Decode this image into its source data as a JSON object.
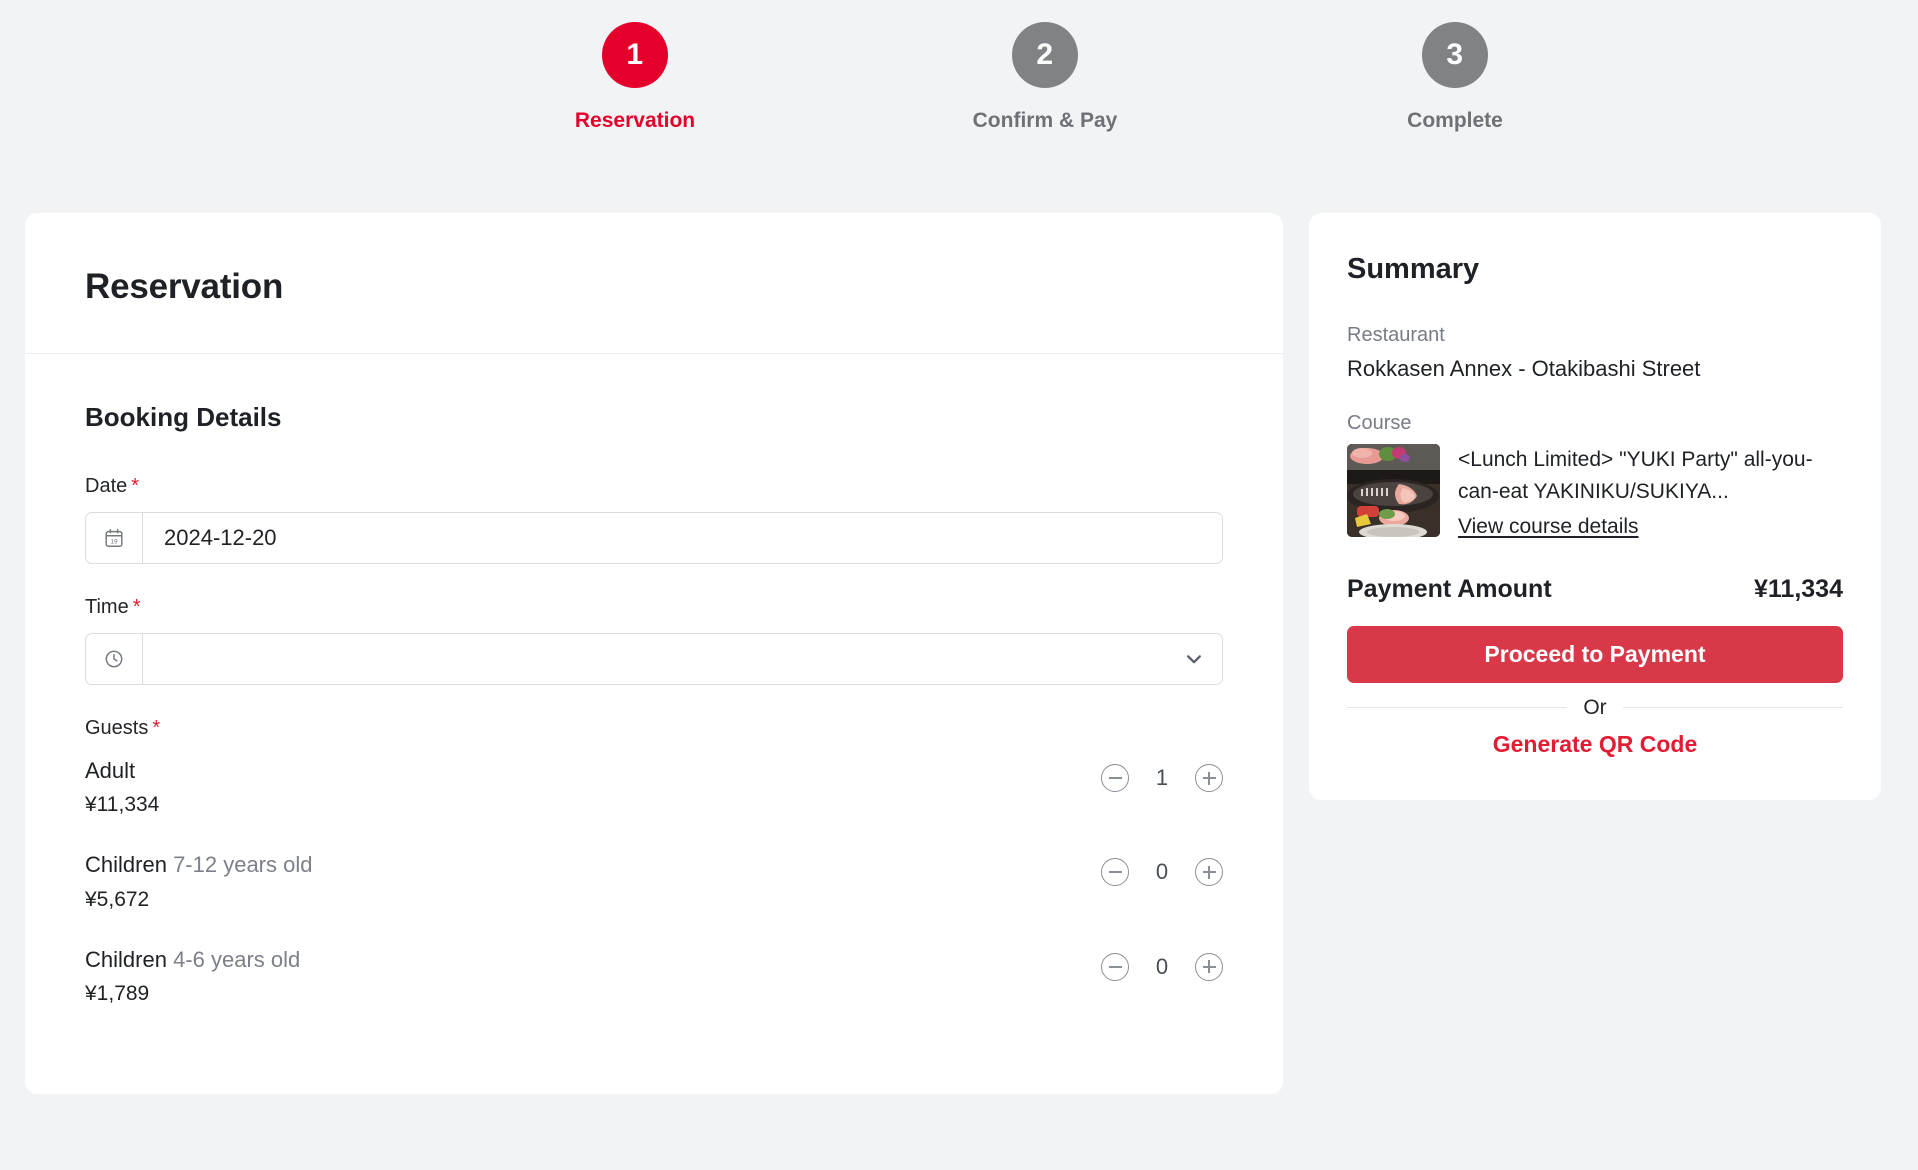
{
  "stepper": {
    "steps": [
      {
        "number": "1",
        "label": "Reservation",
        "state": "active"
      },
      {
        "number": "2",
        "label": "Confirm & Pay",
        "state": "inactive"
      },
      {
        "number": "3",
        "label": "Complete",
        "state": "inactive"
      }
    ]
  },
  "reservation": {
    "heading": "Reservation",
    "section_title": "Booking Details",
    "date": {
      "label": "Date",
      "required_mark": "*",
      "value": "2024-12-20",
      "icon": "calendar-icon",
      "icon_day": "19"
    },
    "time": {
      "label": "Time",
      "required_mark": "*",
      "value": "",
      "icon": "clock-icon",
      "caret": "chevron-down-icon"
    },
    "guests": {
      "label": "Guests",
      "required_mark": "*",
      "rows": [
        {
          "name": "Adult",
          "age": "",
          "price": "¥11,334",
          "count": "1"
        },
        {
          "name": "Children",
          "age": "7-12 years old",
          "price": "¥5,672",
          "count": "0"
        },
        {
          "name": "Children",
          "age": "4-6 years old",
          "price": "¥1,789",
          "count": "0"
        }
      ],
      "decrement_icon": "minus-circle-icon",
      "increment_icon": "plus-circle-icon"
    }
  },
  "summary": {
    "heading": "Summary",
    "restaurant_label": "Restaurant",
    "restaurant_value": "Rokkasen Annex - Otakibashi Street",
    "course_label": "Course",
    "course_title": "<Lunch Limited> \"YUKI Party\" all-you-can-eat YAKINIKU/SUKIYA...",
    "course_link": "View course details",
    "course_thumb_icon": "yakiniku-grill-photo",
    "payment_label": "Payment Amount",
    "payment_amount": "¥11,334",
    "pay_button": "Proceed to Payment",
    "or_text": "Or",
    "qr_link": "Generate QR Code"
  },
  "colors": {
    "accent_red": "#e4002b",
    "button_red": "#d93848",
    "qr_red": "#e31b33",
    "inactive_gray": "#808285",
    "page_bg": "#f1f3f5"
  }
}
